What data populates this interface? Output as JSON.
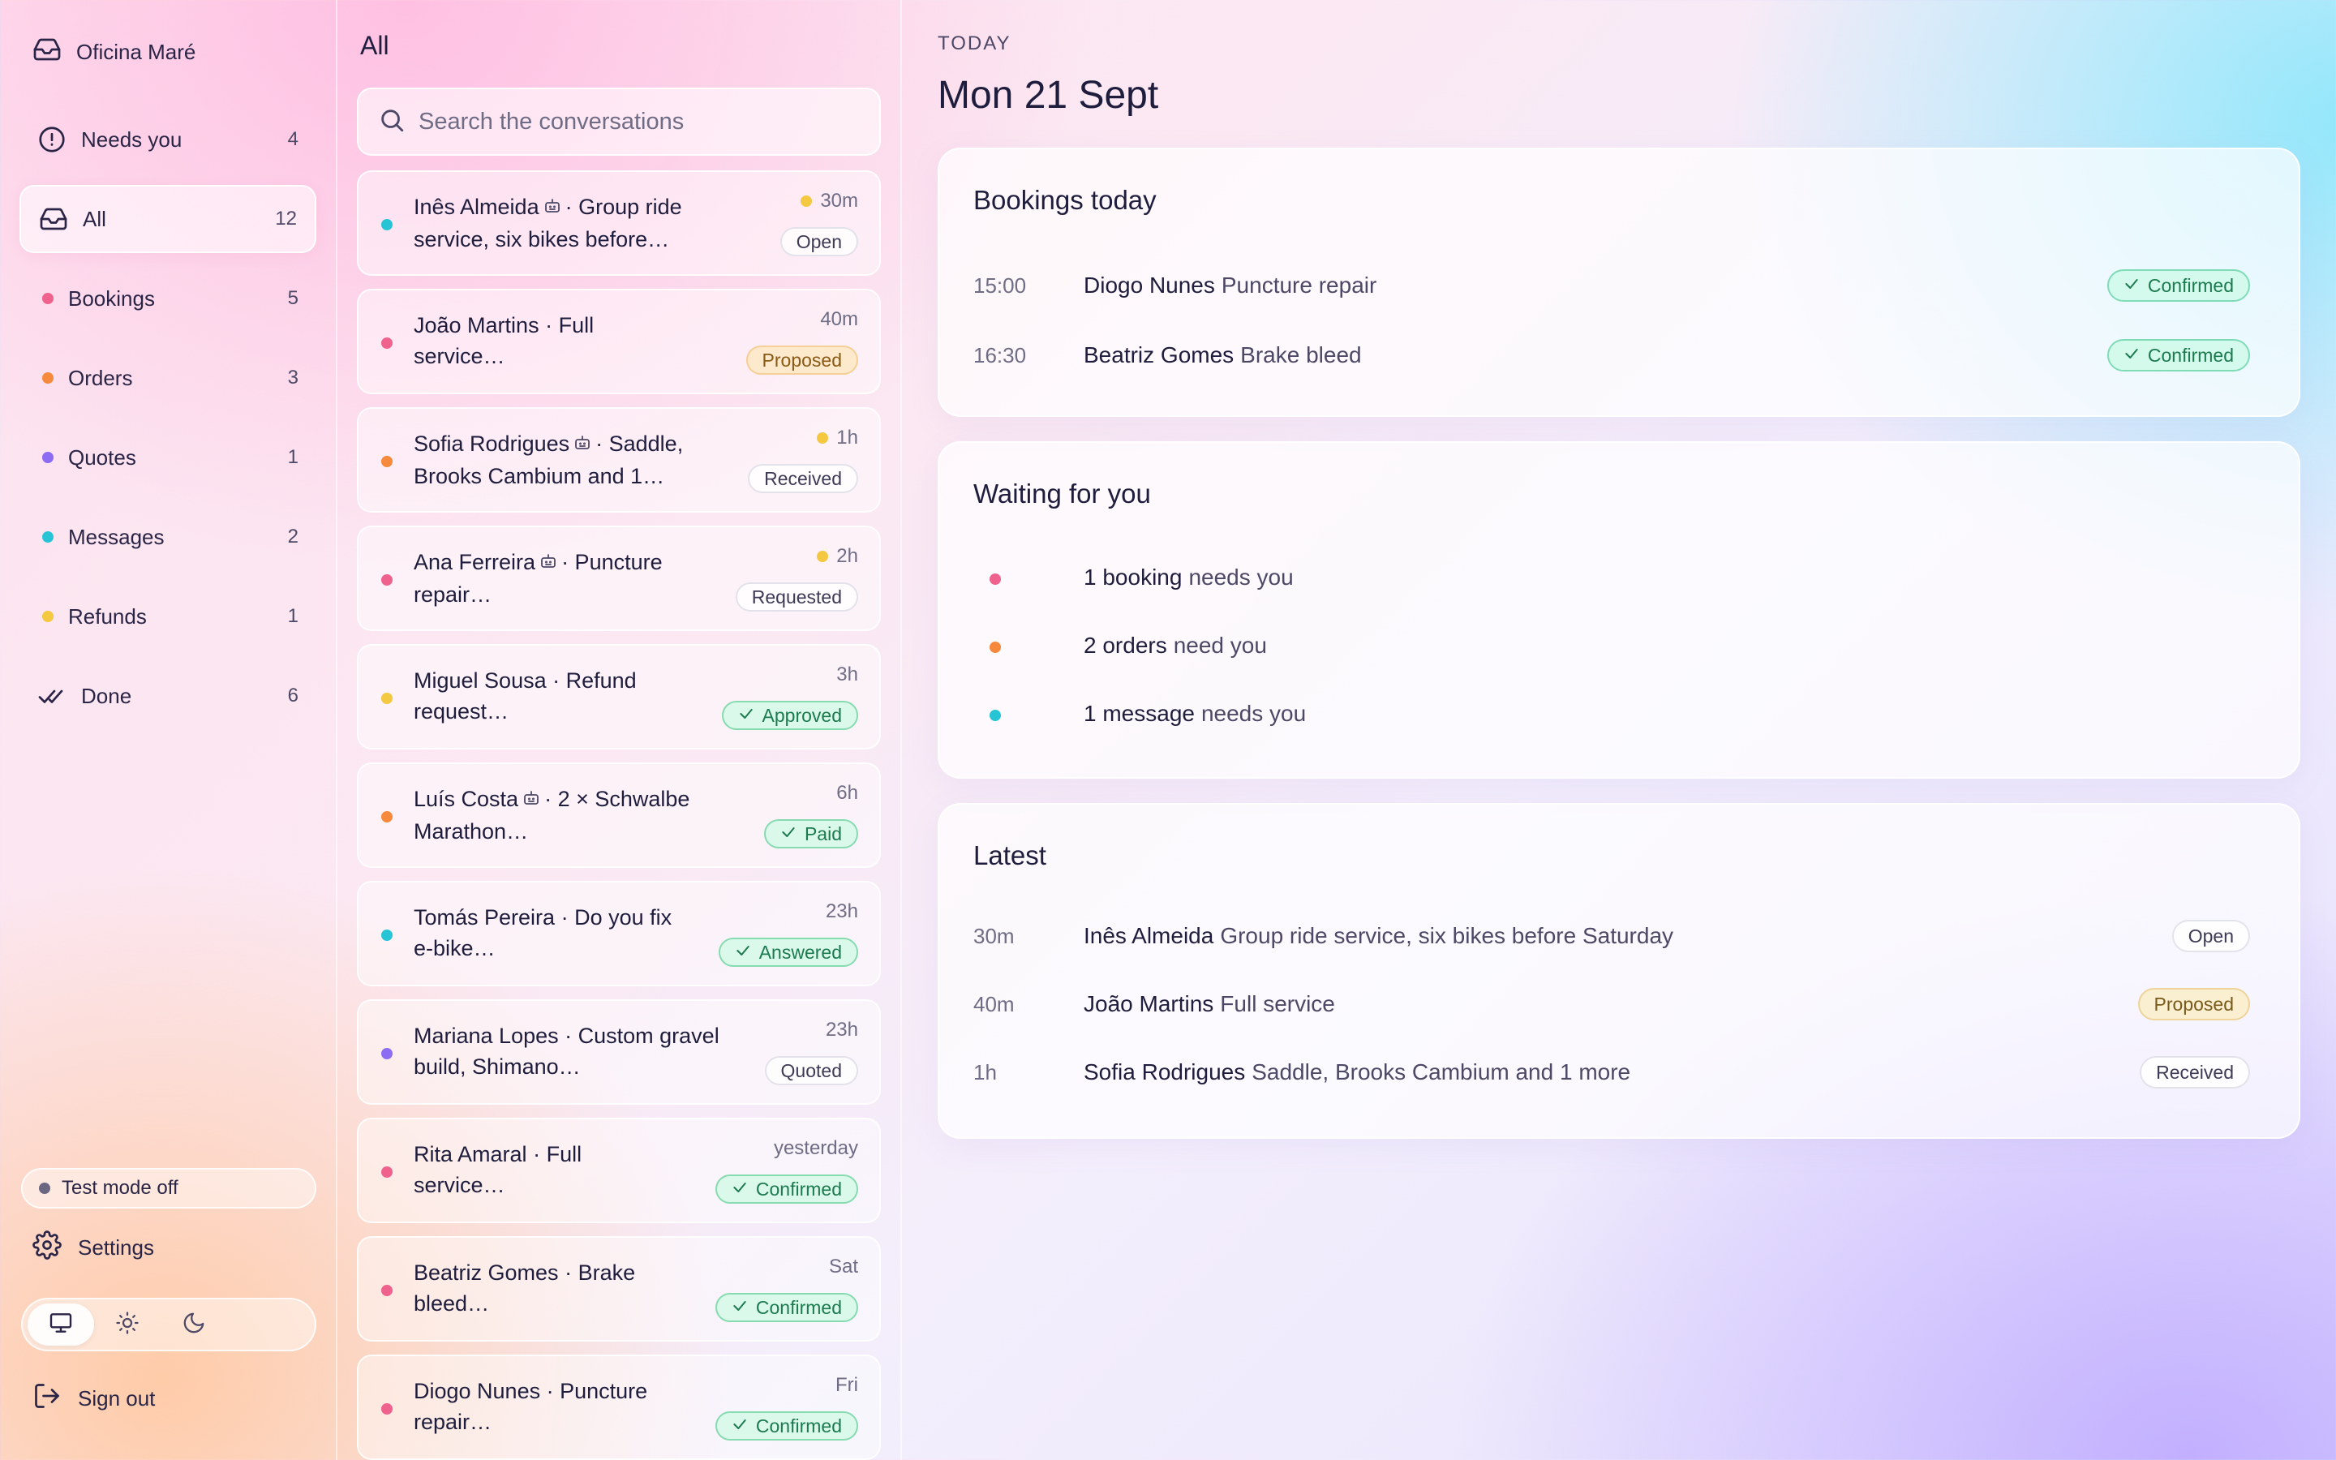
{
  "sidebar": {
    "brand": "Oficina Maré",
    "nav": [
      {
        "label": "Needs you",
        "count": "4"
      },
      {
        "label": "All",
        "count": "12"
      },
      {
        "label": "Bookings",
        "count": "5",
        "color": "#f0628e"
      },
      {
        "label": "Orders",
        "count": "3",
        "color": "#f7893d"
      },
      {
        "label": "Quotes",
        "count": "1",
        "color": "#8b6cf2"
      },
      {
        "label": "Messages",
        "count": "2",
        "color": "#27c4d6"
      },
      {
        "label": "Refunds",
        "count": "1",
        "color": "#f5c842"
      },
      {
        "label": "Done",
        "count": "6"
      }
    ],
    "test_mode": "Test mode off",
    "settings": "Settings",
    "sign_out": "Sign out",
    "theme_icons": [
      "monitor-icon",
      "sun-icon",
      "moon-icon"
    ]
  },
  "list": {
    "title": "All",
    "search_placeholder": "Search the conversations",
    "items": [
      {
        "line1": "Inês Almeida",
        "bot": true,
        "line1b": "· Group ride",
        "line2": "service, six bikes before…",
        "time": "30m",
        "unread": true,
        "status": "Open",
        "dot": "#27c4d6"
      },
      {
        "line1": "João Martins",
        "bot": false,
        "line1b": "· Full",
        "line2": "service…",
        "time": "40m",
        "unread": false,
        "status": "Proposed",
        "dot": "#f0628e"
      },
      {
        "line1": "Sofia Rodrigues",
        "bot": true,
        "line1b": "· Saddle,",
        "line2": "Brooks Cambium and 1…",
        "time": "1h",
        "unread": true,
        "status": "Received",
        "dot": "#f7893d"
      },
      {
        "line1": "Ana Ferreira",
        "bot": true,
        "line1b": "· Puncture",
        "line2": "repair…",
        "time": "2h",
        "unread": true,
        "status": "Requested",
        "dot": "#f0628e"
      },
      {
        "line1": "Miguel Sousa",
        "bot": false,
        "line1b": "· Refund",
        "line2": "request…",
        "time": "3h",
        "unread": false,
        "status": "Approved",
        "dot": "#f5c842"
      },
      {
        "line1": "Luís Costa",
        "bot": true,
        "line1b": "· 2 × Schwalbe",
        "line2": "Marathon…",
        "time": "6h",
        "unread": false,
        "status": "Paid",
        "dot": "#f7893d"
      },
      {
        "line1": "Tomás Pereira",
        "bot": false,
        "line1b": "· Do you fix",
        "line2": "e-bike…",
        "time": "23h",
        "unread": false,
        "status": "Answered",
        "dot": "#27c4d6"
      },
      {
        "line1": "Mariana Lopes",
        "bot": false,
        "line1b": "· Custom gravel",
        "line2": "build, Shimano…",
        "time": "23h",
        "unread": false,
        "status": "Quoted",
        "dot": "#8b6cf2"
      },
      {
        "line1": "Rita Amaral",
        "bot": false,
        "line1b": "· Full",
        "line2": "service…",
        "time": "yesterday",
        "unread": false,
        "status": "Confirmed",
        "dot": "#f0628e"
      },
      {
        "line1": "Beatriz Gomes",
        "bot": false,
        "line1b": "· Brake",
        "line2": "bleed…",
        "time": "Sat",
        "unread": false,
        "status": "Confirmed",
        "dot": "#f0628e"
      },
      {
        "line1": "Diogo Nunes",
        "bot": false,
        "line1b": "· Puncture",
        "line2": "repair…",
        "time": "Fri",
        "unread": false,
        "status": "Confirmed",
        "dot": "#f0628e"
      }
    ]
  },
  "main": {
    "today_label": "TODAY",
    "date": "Mon 21 Sept",
    "bookings": {
      "title": "Bookings today",
      "rows": [
        {
          "time": "15:00",
          "name": "Diogo Nunes",
          "desc": "Puncture repair",
          "status": "Confirmed"
        },
        {
          "time": "16:30",
          "name": "Beatriz Gomes",
          "desc": "Brake bleed",
          "status": "Confirmed"
        }
      ]
    },
    "waiting": {
      "title": "Waiting for you",
      "rows": [
        {
          "bold": "1 booking",
          "rest": "needs you",
          "color": "#f0628e"
        },
        {
          "bold": "2 orders",
          "rest": "need you",
          "color": "#f7893d"
        },
        {
          "bold": "1 message",
          "rest": "needs you",
          "color": "#27c4d6"
        }
      ]
    },
    "latest": {
      "title": "Latest",
      "rows": [
        {
          "time": "30m",
          "name": "Inês Almeida",
          "desc": "Group ride service, six bikes before Saturday",
          "status": "Open"
        },
        {
          "time": "40m",
          "name": "João Martins",
          "desc": "Full service",
          "status": "Proposed"
        },
        {
          "time": "1h",
          "name": "Sofia Rodrigues",
          "desc": "Saddle, Brooks Cambium and 1 more",
          "status": "Received"
        }
      ]
    }
  },
  "colors": {
    "bookings": "#f0628e",
    "orders": "#f7893d",
    "quotes": "#8b6cf2",
    "messages": "#27c4d6",
    "refunds": "#f5c842",
    "confirmed": "#1c7a4f",
    "proposed": "#8a5a14"
  }
}
